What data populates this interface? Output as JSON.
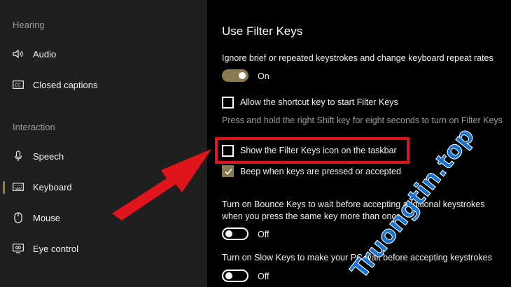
{
  "sidebar": {
    "sections": [
      {
        "header": "Hearing",
        "items": [
          {
            "label": "Audio",
            "icon": "speaker-icon"
          },
          {
            "label": "Closed captions",
            "icon": "cc-icon"
          }
        ]
      },
      {
        "header": "Interaction",
        "items": [
          {
            "label": "Speech",
            "icon": "microphone-icon"
          },
          {
            "label": "Keyboard",
            "icon": "keyboard-icon",
            "selected": true
          },
          {
            "label": "Mouse",
            "icon": "mouse-icon"
          },
          {
            "label": "Eye control",
            "icon": "eye-icon"
          }
        ]
      }
    ]
  },
  "main": {
    "title": "Use Filter Keys",
    "ignore_desc": "Ignore brief or repeated keystrokes and change keyboard repeat rates",
    "filter_toggle_state": "On",
    "allow_shortcut_label": "Allow the shortcut key to start Filter Keys",
    "shortcut_hint": "Press and hold the right Shift key for eight seconds to turn on Filter Keys",
    "show_icon_label": "Show the Filter Keys icon on the taskbar",
    "beep_label": "Beep when keys are pressed or accepted",
    "bounce_desc_line1": "Turn on Bounce Keys to wait before accepting additional keystrokes",
    "bounce_desc_line2": "when you press the same key more than once",
    "bounce_toggle_state": "Off",
    "slow_desc": "Turn on Slow Keys to make your PC wait before accepting keystrokes",
    "slow_toggle_state": "Off"
  },
  "watermark": {
    "text": "Truongtin.top"
  },
  "colors": {
    "accent": "#8a7a4f",
    "highlight": "#e0141b",
    "sidebar_bg": "#1f1f1f"
  }
}
